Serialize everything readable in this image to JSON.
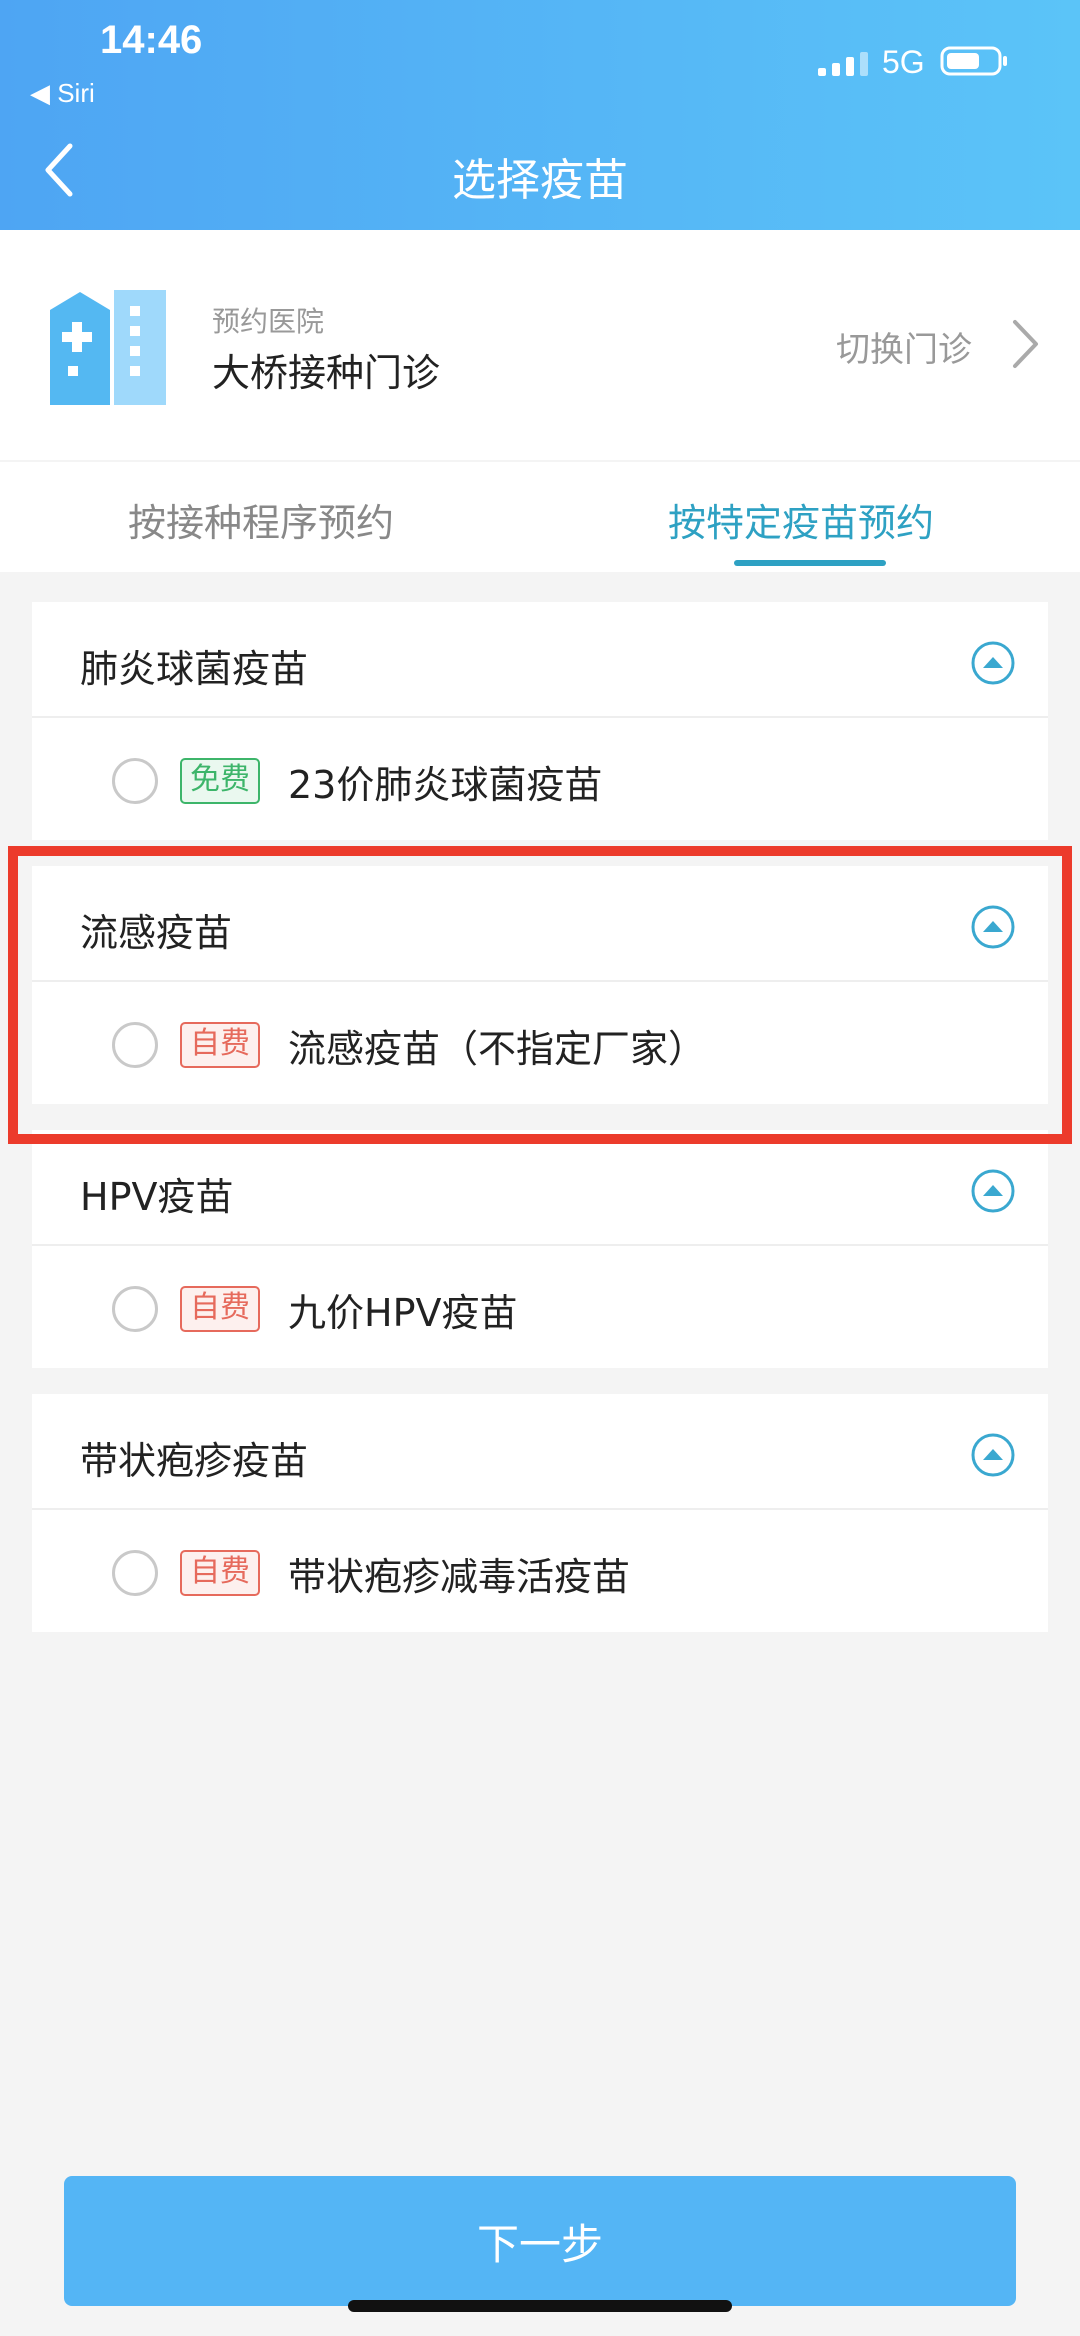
{
  "status_bar": {
    "time": "14:46",
    "back_app": "◀ Siri",
    "network": "5G",
    "icons": [
      "signal-icon",
      "battery-icon"
    ]
  },
  "nav": {
    "title": "选择疫苗",
    "back_icon": "chevron-left-icon"
  },
  "hospital": {
    "caption": "预约医院",
    "name": "大桥接种门诊",
    "switch_label": "切换门诊",
    "icon": "hospital-building-icon"
  },
  "tabs": [
    {
      "label": "按接种程序预约",
      "active": false
    },
    {
      "label": "按特定疫苗预约",
      "active": true
    }
  ],
  "groups": [
    {
      "title": "肺炎球菌疫苗",
      "items": [
        {
          "tag": "免费",
          "tag_type": "free",
          "name": "23价肺炎球菌疫苗"
        }
      ]
    },
    {
      "title": "流感疫苗",
      "items": [
        {
          "tag": "自费",
          "tag_type": "self",
          "name": "流感疫苗（不指定厂家）"
        }
      ]
    },
    {
      "title": "HPV疫苗",
      "items": [
        {
          "tag": "自费",
          "tag_type": "self",
          "name": "九价HPV疫苗"
        }
      ]
    },
    {
      "title": "带状疱疹疫苗",
      "items": [
        {
          "tag": "自费",
          "tag_type": "self",
          "name": "带状疱疹减毒活疫苗"
        }
      ]
    }
  ],
  "next_button": "下一步",
  "colors": {
    "header_gradient_start": "#4ea5f3",
    "header_gradient_end": "#5bc4f8",
    "accent": "#2ea1c3",
    "free_tag": "#3db56a",
    "self_pay_tag": "#e66a5c",
    "highlight_box": "#ec3b2b",
    "button": "#54b5f5"
  }
}
